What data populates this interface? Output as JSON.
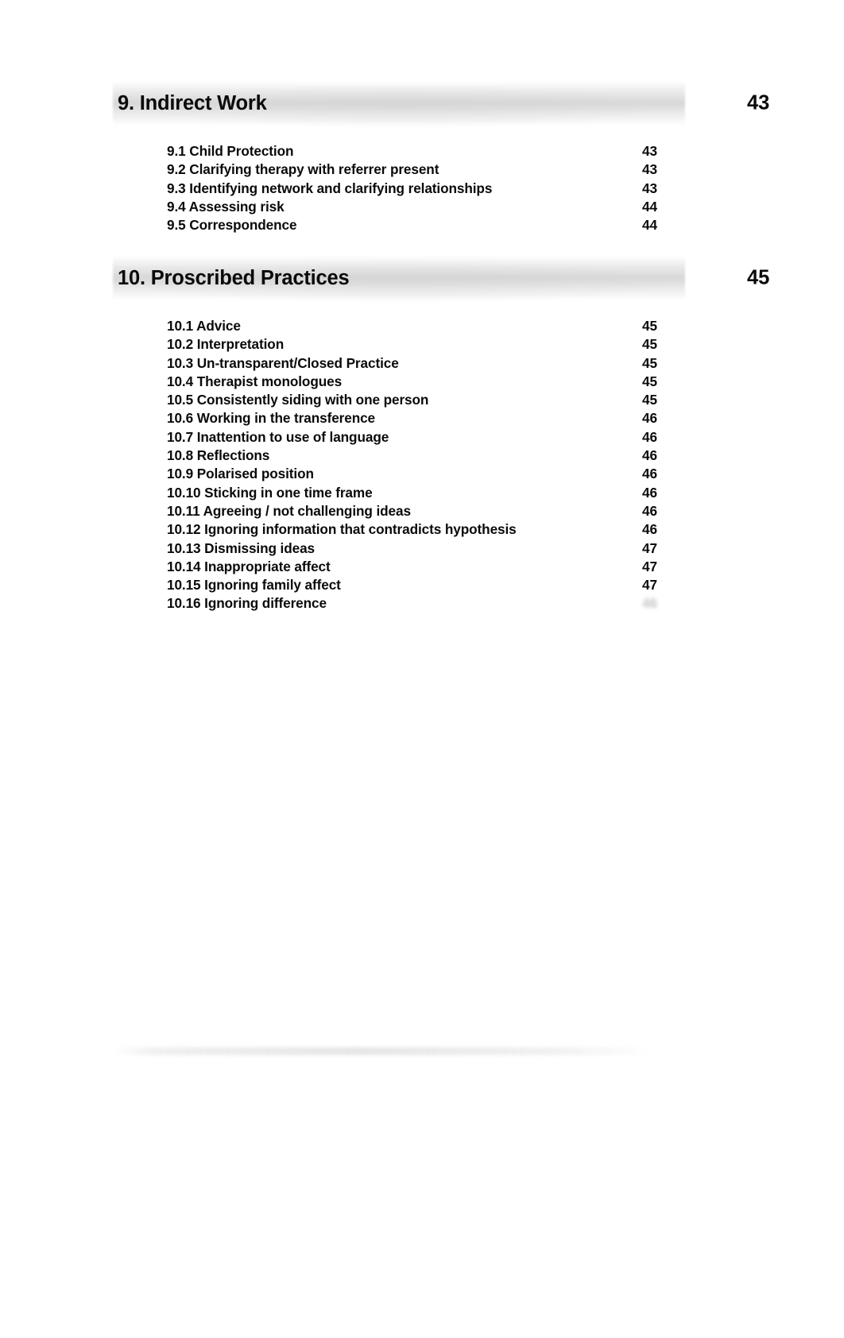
{
  "document": {
    "type": "table-of-contents",
    "page_background": "#ffffff",
    "text_color": "#0a0a0a"
  },
  "sections": [
    {
      "title": "9. Indirect Work",
      "page": "43",
      "items": [
        {
          "label": "9.1 Child Protection",
          "page": "43"
        },
        {
          "label": "9.2 Clarifying therapy with referrer present",
          "page": "43"
        },
        {
          "label": "9.3 Identifying network and clarifying relationships",
          "page": "43"
        },
        {
          "label": "9.4 Assessing risk",
          "page": "44"
        },
        {
          "label": "9.5 Correspondence",
          "page": "44"
        }
      ]
    },
    {
      "title": "10. Proscribed Practices",
      "page": "45",
      "items": [
        {
          "label": "10.1  Advice",
          "page": "45"
        },
        {
          "label": "10.2  Interpretation",
          "page": "45"
        },
        {
          "label": "10.3  Un-transparent/Closed  Practice",
          "page": "45"
        },
        {
          "label": "10.4  Therapist  monologues",
          "page": "45"
        },
        {
          "label": "10.5 Consistently siding  with one person",
          "page": "45"
        },
        {
          "label": "10.6 Working  in  the  transference",
          "page": "46"
        },
        {
          "label": "10.7 Inattention  to  use  of  language",
          "page": "46"
        },
        {
          "label": "10.8  Reflections",
          "page": "46"
        },
        {
          "label": "10.9  Polarised  position",
          "page": "46"
        },
        {
          "label": "10.10  Sticking in one time frame",
          "page": "46"
        },
        {
          "label": "10.11   Agreeing / not challenging ideas",
          "page": "46"
        },
        {
          "label": "10.12  Ignoring information that contradicts hypothesis",
          "page": "46"
        },
        {
          "label": "10.13  Dismissing  ideas",
          "page": "47"
        },
        {
          "label": "10.14  Inappropriate  affect",
          "page": "47"
        },
        {
          "label": "10.15  Ignoring  family  affect",
          "page": "47"
        },
        {
          "label": "10.16  Ignoring  difference",
          "page": "",
          "page_illegible": true
        }
      ]
    }
  ]
}
